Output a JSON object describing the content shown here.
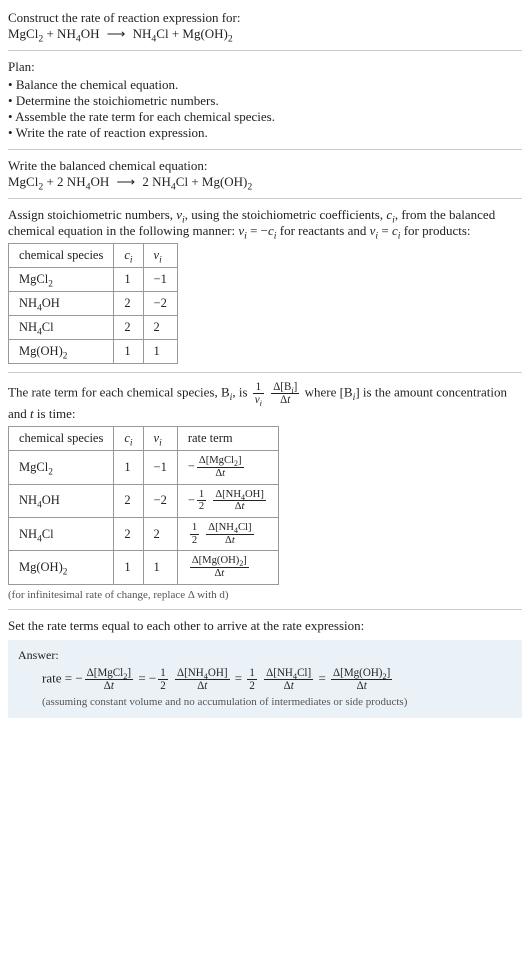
{
  "intro": {
    "prompt": "Construct the rate of reaction expression for:"
  },
  "plan": {
    "heading": "Plan:",
    "items": [
      "Balance the chemical equation.",
      "Determine the stoichiometric numbers.",
      "Assemble the rate term for each chemical species.",
      "Write the rate of reaction expression."
    ]
  },
  "balanced": {
    "heading": "Write the balanced chemical equation:"
  },
  "stoich": {
    "text_before": "Assign stoichiometric numbers, ",
    "text_mid1": ", using the stoichiometric coefficients, ",
    "text_mid2": ", from the balanced chemical equation in the following manner: ",
    "text_mid3": " for reactants and ",
    "text_after": " for products:",
    "headers": {
      "species": "chemical species",
      "ci": "cᵢ",
      "vi": "νᵢ"
    }
  },
  "rateterm": {
    "text1": "The rate term for each chemical species, B",
    "text2": ", is ",
    "text3": " where [B",
    "text4": "] is the amount concentration and ",
    "text5": " is time:",
    "headers": {
      "species": "chemical species",
      "ci": "cᵢ",
      "vi": "νᵢ",
      "rate": "rate term"
    },
    "note": "(for infinitesimal rate of change, replace Δ with d)"
  },
  "setequal": {
    "text": "Set the rate terms equal to each other to arrive at the rate expression:"
  },
  "answer": {
    "label": "Answer:",
    "note": "(assuming constant volume and no accumulation of intermediates or side products)"
  },
  "chart_data": {
    "type": "table",
    "reaction_unbalanced": {
      "reactants": [
        {
          "formula": "MgCl2",
          "coef": 1
        },
        {
          "formula": "NH4OH",
          "coef": 1
        }
      ],
      "products": [
        {
          "formula": "NH4Cl",
          "coef": 1
        },
        {
          "formula": "Mg(OH)2",
          "coef": 1
        }
      ]
    },
    "reaction_balanced": {
      "reactants": [
        {
          "formula": "MgCl2",
          "coef": 1
        },
        {
          "formula": "NH4OH",
          "coef": 2
        }
      ],
      "products": [
        {
          "formula": "NH4Cl",
          "coef": 2
        },
        {
          "formula": "Mg(OH)2",
          "coef": 1
        }
      ]
    },
    "stoich_table": [
      {
        "species": "MgCl2",
        "ci": 1,
        "vi": -1
      },
      {
        "species": "NH4OH",
        "ci": 2,
        "vi": -2
      },
      {
        "species": "NH4Cl",
        "ci": 2,
        "vi": 2
      },
      {
        "species": "Mg(OH)2",
        "ci": 1,
        "vi": 1
      }
    ],
    "rate_table": [
      {
        "species": "MgCl2",
        "ci": 1,
        "vi": -1,
        "rate_coef_sign": "-",
        "rate_coef_frac": null,
        "delta_species": "MgCl2"
      },
      {
        "species": "NH4OH",
        "ci": 2,
        "vi": -2,
        "rate_coef_sign": "-",
        "rate_coef_frac": [
          1,
          2
        ],
        "delta_species": "NH4OH"
      },
      {
        "species": "NH4Cl",
        "ci": 2,
        "vi": 2,
        "rate_coef_sign": "",
        "rate_coef_frac": [
          1,
          2
        ],
        "delta_species": "NH4Cl"
      },
      {
        "species": "Mg(OH)2",
        "ci": 1,
        "vi": 1,
        "rate_coef_sign": "",
        "rate_coef_frac": null,
        "delta_species": "Mg(OH)2"
      }
    ],
    "rate_expression": [
      {
        "sign": "-",
        "frac": null,
        "delta_species": "MgCl2"
      },
      {
        "sign": "-",
        "frac": [
          1,
          2
        ],
        "delta_species": "NH4OH"
      },
      {
        "sign": "",
        "frac": [
          1,
          2
        ],
        "delta_species": "NH4Cl"
      },
      {
        "sign": "",
        "frac": null,
        "delta_species": "Mg(OH)2"
      }
    ]
  }
}
